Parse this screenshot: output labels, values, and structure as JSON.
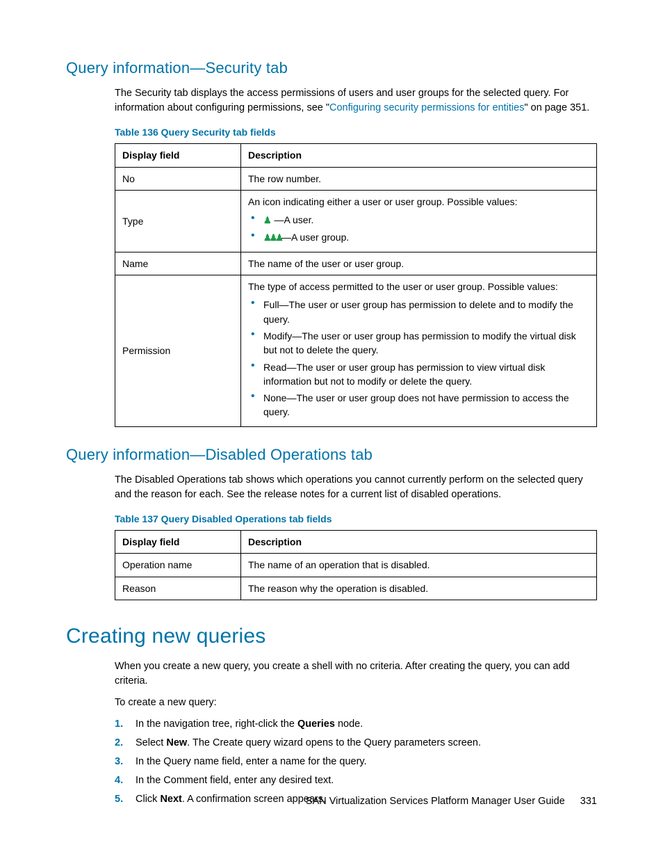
{
  "sec1": {
    "heading": "Query information—Security tab",
    "intro_pre": "The Security tab displays the access permissions of users and user groups for the selected query. For information about configuring permissions, see \"",
    "intro_link": "Configuring security permissions for entities",
    "intro_post": "\" on page 351.",
    "table_caption": "Table 136 Query Security tab fields",
    "th1": "Display field",
    "th2": "Description",
    "rows": {
      "no": {
        "f": "No",
        "d": "The row number."
      },
      "type": {
        "f": "Type",
        "intro": "An icon indicating either a user or user group. Possible values:",
        "user": "—A user.",
        "group": "—A user group."
      },
      "name": {
        "f": "Name",
        "d": "The name of the user or user group."
      },
      "perm": {
        "f": "Permission",
        "intro": "The type of access permitted to the user or user group. Possible values:",
        "b1": "Full—The user or user group has permission to delete and to modify the query.",
        "b2": "Modify—The user or user group has permission to modify the virtual disk but not to delete the query.",
        "b3": "Read—The user or user group has permission to view virtual disk information but not to modify or delete the query.",
        "b4": "None—The user or user group does not have permission to access the query."
      }
    }
  },
  "sec2": {
    "heading": "Query information—Disabled Operations tab",
    "intro": "The Disabled Operations tab shows which operations you cannot currently perform on the selected query and the reason for each. See the release notes for a current list of disabled operations.",
    "table_caption": "Table 137 Query Disabled Operations tab fields",
    "th1": "Display field",
    "th2": "Description",
    "rows": {
      "op": {
        "f": "Operation name",
        "d": "The name of an operation that is disabled."
      },
      "reason": {
        "f": "Reason",
        "d": "The reason why the operation is disabled."
      }
    }
  },
  "sec3": {
    "heading": "Creating new queries",
    "p1": "When you create a new query, you create a shell with no criteria. After creating the query, you can add criteria.",
    "p2": "To create a new query:",
    "steps": {
      "s1a": "In the navigation tree, right-click the ",
      "s1b": "Queries",
      "s1c": " node.",
      "s2a": "Select ",
      "s2b": "New",
      "s2c": ". The Create query wizard opens to the Query parameters screen.",
      "s3": "In the Query name field, enter a name for the query.",
      "s4": "In the Comment field, enter any desired text.",
      "s5a": "Click ",
      "s5b": "Next",
      "s5c": ". A confirmation screen appears."
    }
  },
  "footer": {
    "title": "SAN Virtualization Services Platform Manager User Guide",
    "page": "331"
  }
}
